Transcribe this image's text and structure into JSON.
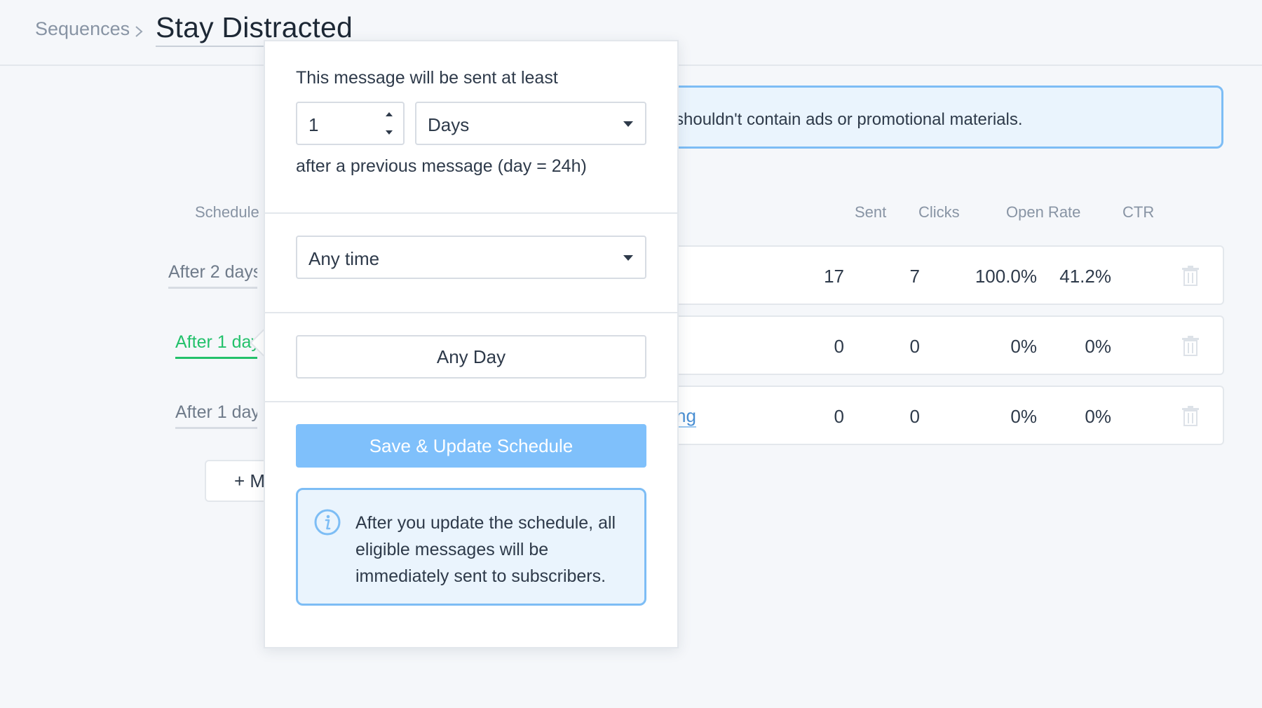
{
  "header": {
    "breadcrumb_parent": "Sequences",
    "title": "Stay Distracted"
  },
  "notice": {
    "text": "e shouldn't contain ads or promotional materials."
  },
  "table": {
    "headers": {
      "schedule": "Schedule",
      "sent": "Sent",
      "clicks": "Clicks",
      "open_rate": "Open Rate",
      "ctr": "CTR"
    },
    "rows": [
      {
        "schedule": "After 2 days",
        "link": "",
        "sent": "17",
        "clicks": "7",
        "open_rate": "100.0%",
        "ctr": "41.2%"
      },
      {
        "schedule": "After 1 day",
        "link": "",
        "sent": "0",
        "clicks": "0",
        "open_rate": "0%",
        "ctr": "0%"
      },
      {
        "schedule": "After 1 day",
        "link": "ng",
        "sent": "0",
        "clicks": "0",
        "open_rate": "0%",
        "ctr": "0%"
      }
    ],
    "add_button": "+ M"
  },
  "popover": {
    "intro": "This message will be sent at least",
    "amount": "1",
    "unit": "Days",
    "suffix": "after a previous message (day = 24h)",
    "time_select": "Any time",
    "day_button": "Any Day",
    "save_button": "Save & Update Schedule",
    "info": "After you update the schedule, all eligible messages will be immediately sent to subscribers."
  },
  "colors": {
    "accent_green": "#23c16b",
    "info_blue": "#7dbdf5",
    "save_blue": "#7fc0fb",
    "link_blue": "#4a8fd3"
  },
  "icons": [
    "chevron-right-icon",
    "trash-icon",
    "caret-down-icon",
    "stepper-icon",
    "info-icon"
  ]
}
